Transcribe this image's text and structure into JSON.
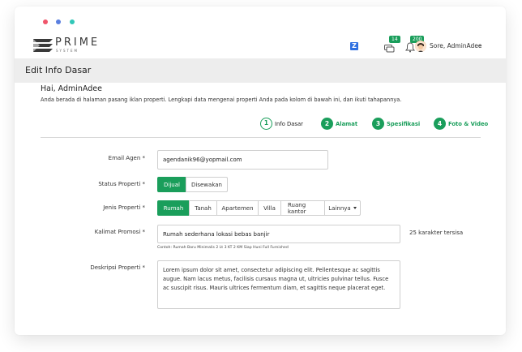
{
  "window": {
    "dots": [
      "red",
      "blue",
      "teal"
    ]
  },
  "nav": {
    "logo_text": "PRIME",
    "logo_sub": "SYSTEM",
    "z_label": "Z",
    "messages_count": "14",
    "notifications_count": "200",
    "user_greeting": "Sore, AdminAdee",
    "user_chevron": "⌄"
  },
  "page": {
    "title": "Edit Info Dasar",
    "greeting": "Hai, AdminAdee",
    "intro": "Anda berada di halaman pasang iklan properti. Lengkapi data mengenai properti Anda pada kolom di bawah ini, dan ikuti tahapannya."
  },
  "steps": [
    {
      "num": "1",
      "label": "Info Dasar"
    },
    {
      "num": "2",
      "label": "Alamat"
    },
    {
      "num": "3",
      "label": "Spesifikasi"
    },
    {
      "num": "4",
      "label": "Foto & Video"
    }
  ],
  "form": {
    "email_label": "Email Agen *",
    "email_value": "agendanik96@yopmail.com",
    "status_label": "Status Properti *",
    "status_options": [
      "Dijual",
      "Disewakan"
    ],
    "jenis_label": "Jenis Properti *",
    "jenis_options": [
      "Rumah",
      "Tanah",
      "Apartemen",
      "Villa",
      "Ruang kantor",
      "Lainnya"
    ],
    "kalimat_label": "Kalimat Promosi *",
    "kalimat_value": "Rumah sederhana lokasi bebas banjir",
    "kalimat_counter": "25 karakter tersisa",
    "kalimat_helper": "Contoh: Rumah Baru Minimalis 2 Lt 3 KT 2 KM Siap Huni Full Furnished",
    "deskripsi_label": "Deskripsi Properti *",
    "deskripsi_value": "Lorem ipsum dolor sit amet, consectetur adipiscing elit. Pellentesque ac sagittis augue. Nam lacus metus, facilisis cursaus magna ut, ultricies pulvinar tellus. Fusce ac suscipit risus. Mauris ultrices fermentum diam, et sagittis neque placerat eget."
  },
  "colors": {
    "accent": "#1a9e5b",
    "z_badge": "#2e6fe0"
  }
}
